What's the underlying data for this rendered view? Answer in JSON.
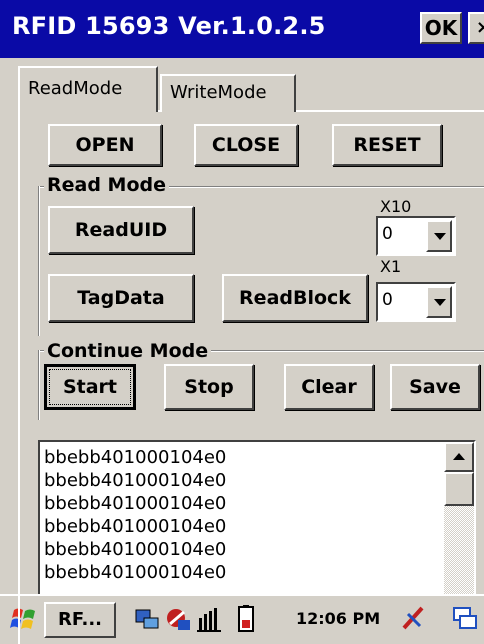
{
  "window": {
    "title": "RFID 15693 Ver.1.0.2.5",
    "ok_label": "OK",
    "close_label": "×"
  },
  "tabs": [
    {
      "label": "ReadMode",
      "active": true
    },
    {
      "label": "WriteMode",
      "active": false
    }
  ],
  "buttons": {
    "open": "OPEN",
    "close": "CLOSE",
    "reset": "RESET",
    "readuid": "ReadUID",
    "tagdata": "TagData",
    "readblock": "ReadBlock",
    "start": "Start",
    "stop": "Stop",
    "clear": "Clear",
    "save": "Save"
  },
  "read_mode": {
    "group_label": "Read Mode",
    "x10_label": "X10",
    "x10_value": "0",
    "x1_label": "X1",
    "x1_value": "0"
  },
  "continue_mode": {
    "group_label": "Continue Mode"
  },
  "log": {
    "items": [
      "bbebb401000104e0",
      "bbebb401000104e0",
      "bbebb401000104e0",
      "bbebb401000104e0",
      "bbebb401000104e0",
      "bbebb401000104e0"
    ]
  },
  "taskbar": {
    "app_label": "RF...",
    "clock": "12:06 PM",
    "icons": [
      "start-flag-icon",
      "network-icon",
      "connection-icon",
      "signal-icon",
      "battery-icon",
      "input-method-icon",
      "window-switch-icon"
    ]
  },
  "colors": {
    "titlebar": "#0a0aa6",
    "face": "#d4d0c8"
  }
}
